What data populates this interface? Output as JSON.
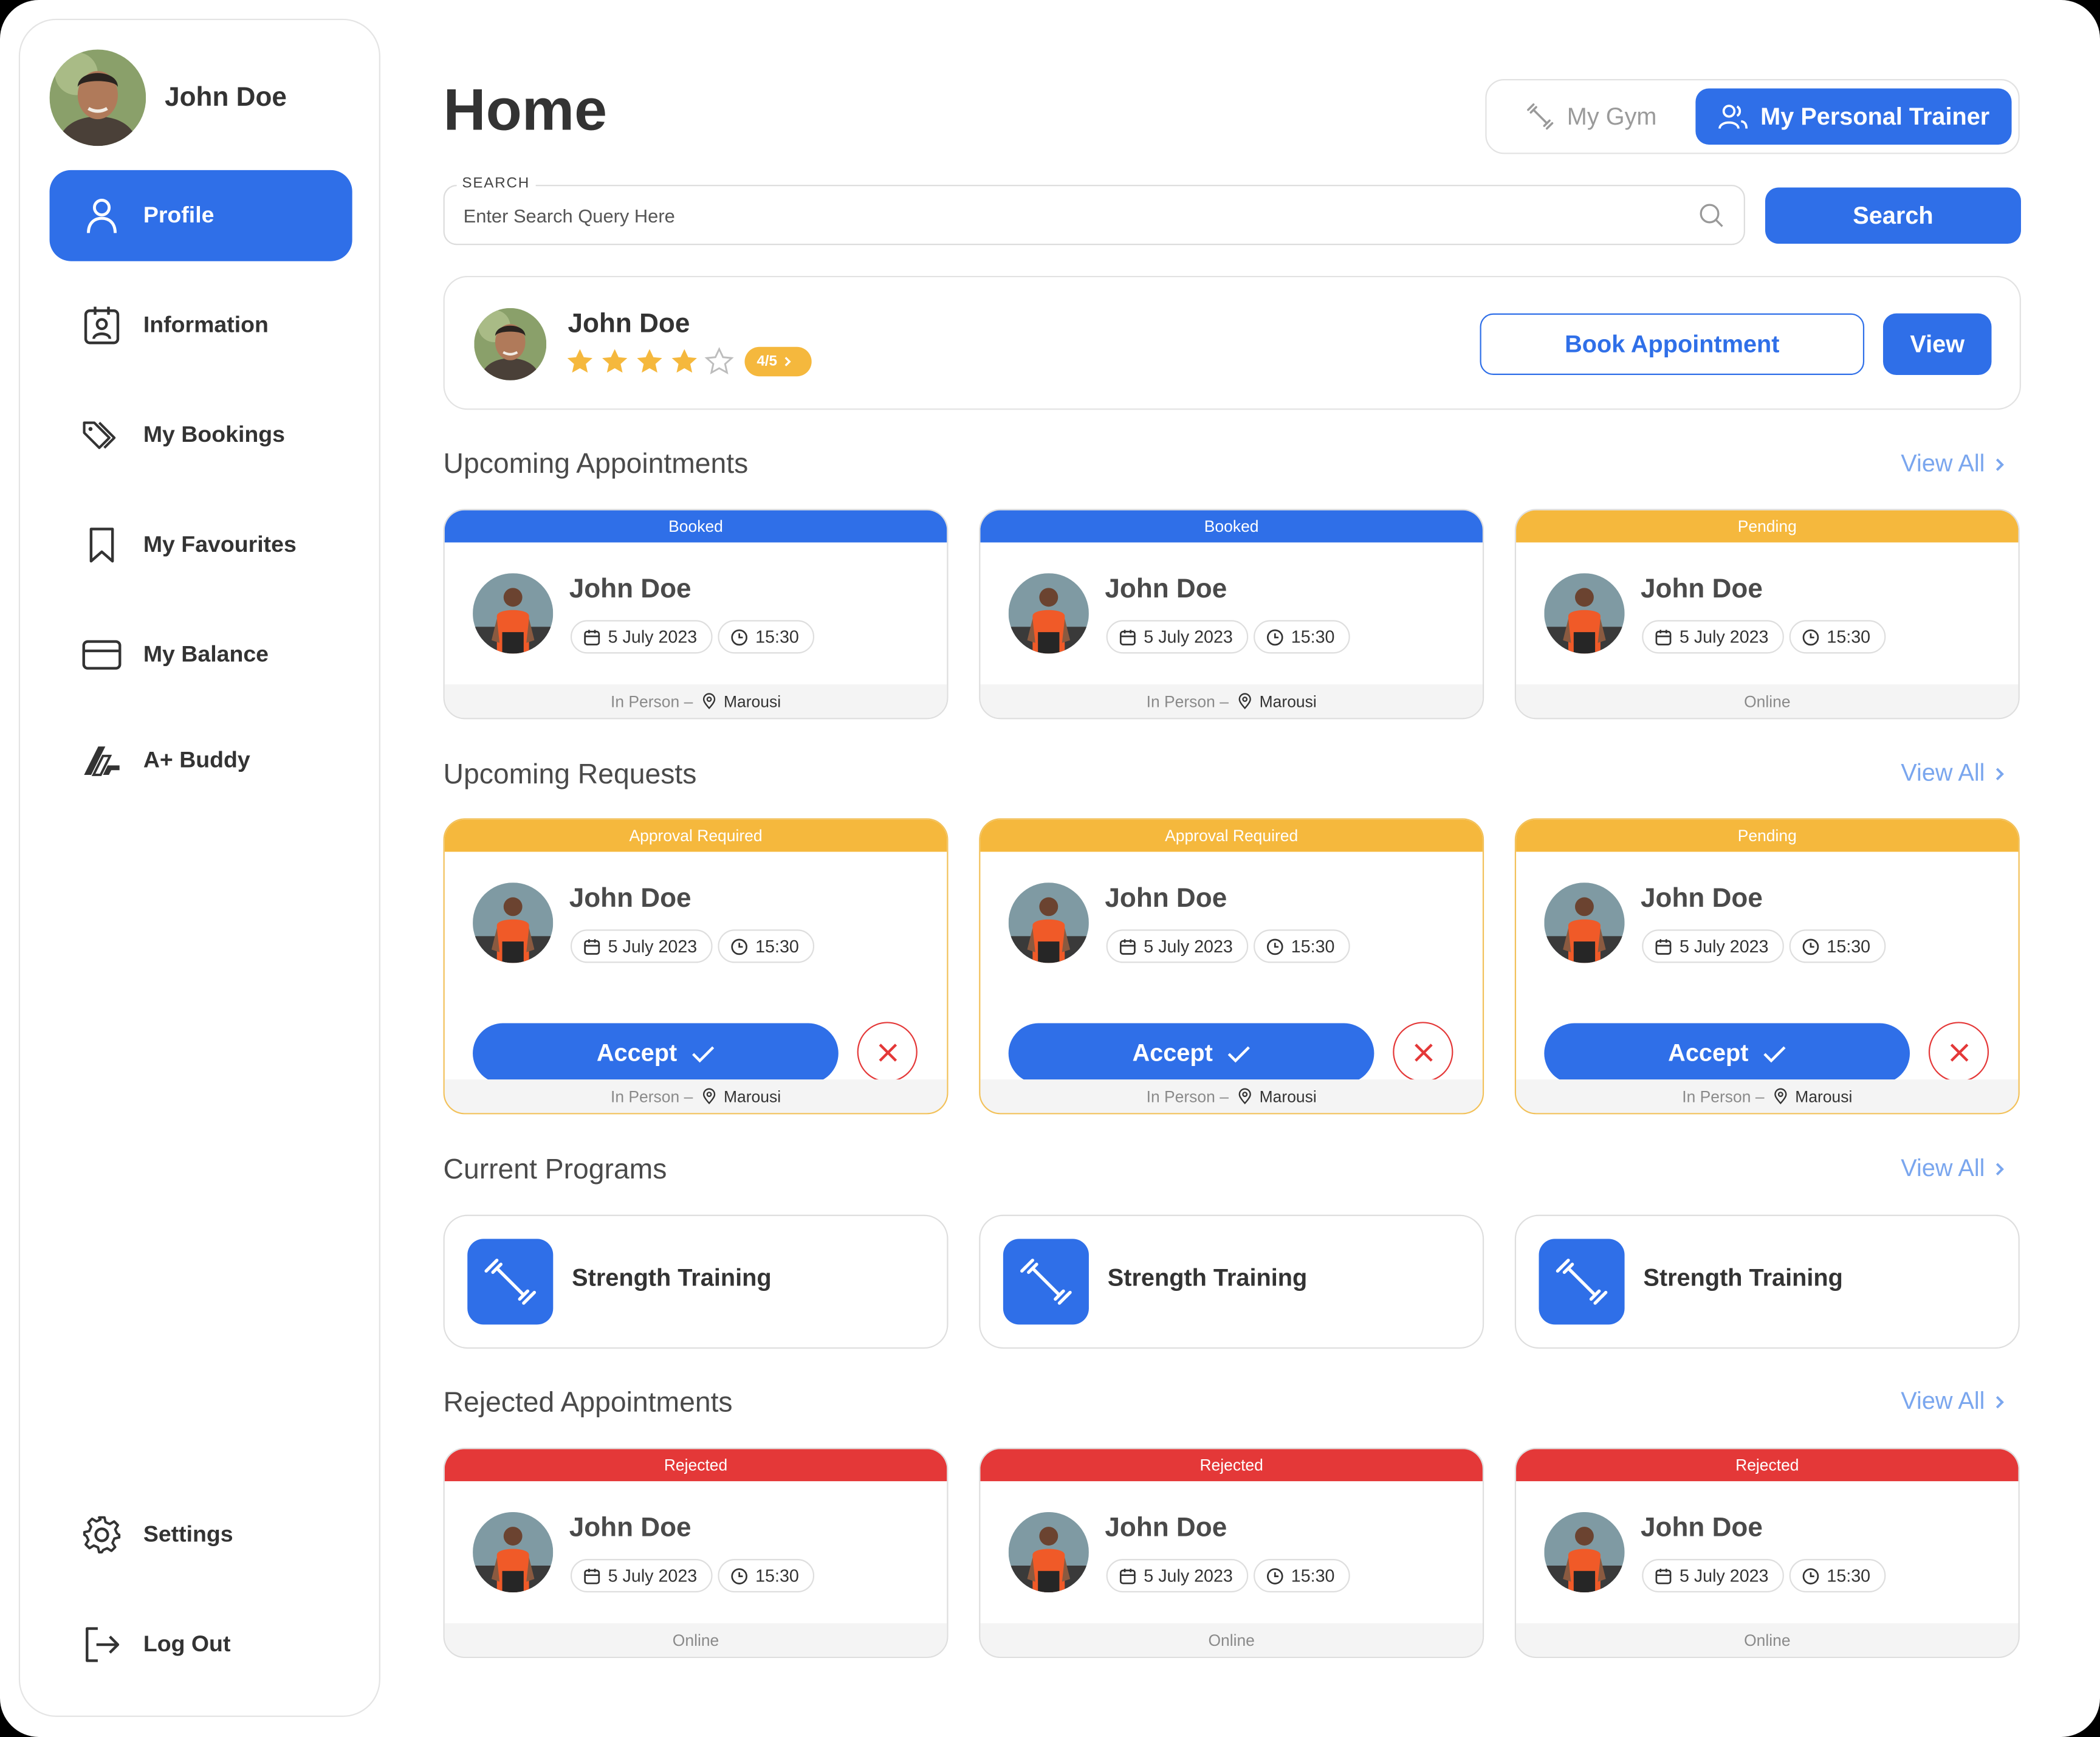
{
  "sidebar": {
    "user_name": "John Doe",
    "items": [
      {
        "label": "Profile"
      },
      {
        "label": "Information"
      },
      {
        "label": "My Bookings"
      },
      {
        "label": "My Favourites"
      },
      {
        "label": "My Balance"
      },
      {
        "label": "A+ Buddy"
      },
      {
        "label": "Settings"
      },
      {
        "label": "Log Out"
      }
    ]
  },
  "header": {
    "title": "Home",
    "toggle": {
      "gym": "My Gym",
      "trainer": "My Personal Trainer",
      "active": "trainer"
    }
  },
  "search": {
    "label": "SEARCH",
    "placeholder": "Enter Search Query Here",
    "value": "",
    "button": "Search"
  },
  "trainer_card": {
    "name": "John Doe",
    "stars_filled": 4,
    "stars_total": 5,
    "rating": "4/5",
    "book_button": "Book Appointment",
    "view_button": "View"
  },
  "sections": {
    "upcoming_appointments": {
      "title": "Upcoming Appointments",
      "view_all": "View All",
      "cards": [
        {
          "status": "Booked",
          "status_color": "#2f6fe8",
          "name": "John Doe",
          "date": "5 July 2023",
          "time": "15:30",
          "mode": "In Person",
          "sep": "–",
          "location": "Marousi"
        },
        {
          "status": "Booked",
          "status_color": "#2f6fe8",
          "name": "John Doe",
          "date": "5 July 2023",
          "time": "15:30",
          "mode": "In Person",
          "sep": "–",
          "location": "Marousi"
        },
        {
          "status": "Pending",
          "status_color": "#f5b83d",
          "name": "John Doe",
          "date": "5 July 2023",
          "time": "15:30",
          "mode": "Online"
        }
      ]
    },
    "upcoming_requests": {
      "title": "Upcoming Requests",
      "view_all": "View All",
      "accept_label": "Accept",
      "cards": [
        {
          "status": "Approval Required",
          "status_color": "#f5b83d",
          "name": "John Doe",
          "date": "5 July 2023",
          "time": "15:30",
          "mode": "In Person",
          "sep": "–",
          "location": "Marousi"
        },
        {
          "status": "Approval Required",
          "status_color": "#f5b83d",
          "name": "John Doe",
          "date": "5 July 2023",
          "time": "15:30",
          "mode": "In Person",
          "sep": "–",
          "location": "Marousi"
        },
        {
          "status": "Pending",
          "status_color": "#f5b83d",
          "name": "John Doe",
          "date": "5 July 2023",
          "time": "15:30",
          "mode": "In Person",
          "sep": "–",
          "location": "Marousi"
        }
      ]
    },
    "current_programs": {
      "title": "Current Programs",
      "view_all": "View All",
      "items": [
        {
          "label": "Strength Training",
          "icon": "dumbbell-icon"
        },
        {
          "label": "Strength Training",
          "icon": "dumbbell-icon"
        },
        {
          "label": "Strength Training",
          "icon": "dumbbell-icon"
        }
      ]
    },
    "rejected_appointments": {
      "title": "Rejected Appointments",
      "view_all": "View All",
      "cards": [
        {
          "status": "Rejected",
          "status_color": "#e43838",
          "name": "John Doe",
          "date": "5 July 2023",
          "time": "15:30",
          "mode": "Online"
        },
        {
          "status": "Rejected",
          "status_color": "#e43838",
          "name": "John Doe",
          "date": "5 July 2023",
          "time": "15:30",
          "mode": "Online"
        },
        {
          "status": "Rejected",
          "status_color": "#e43838",
          "name": "John Doe",
          "date": "5 July 2023",
          "time": "15:30",
          "mode": "Online"
        }
      ]
    }
  },
  "colors": {
    "accent": "#2f6fe8",
    "pending": "#f5b83d",
    "rejected": "#e43838",
    "link": "#7aa6ee"
  }
}
